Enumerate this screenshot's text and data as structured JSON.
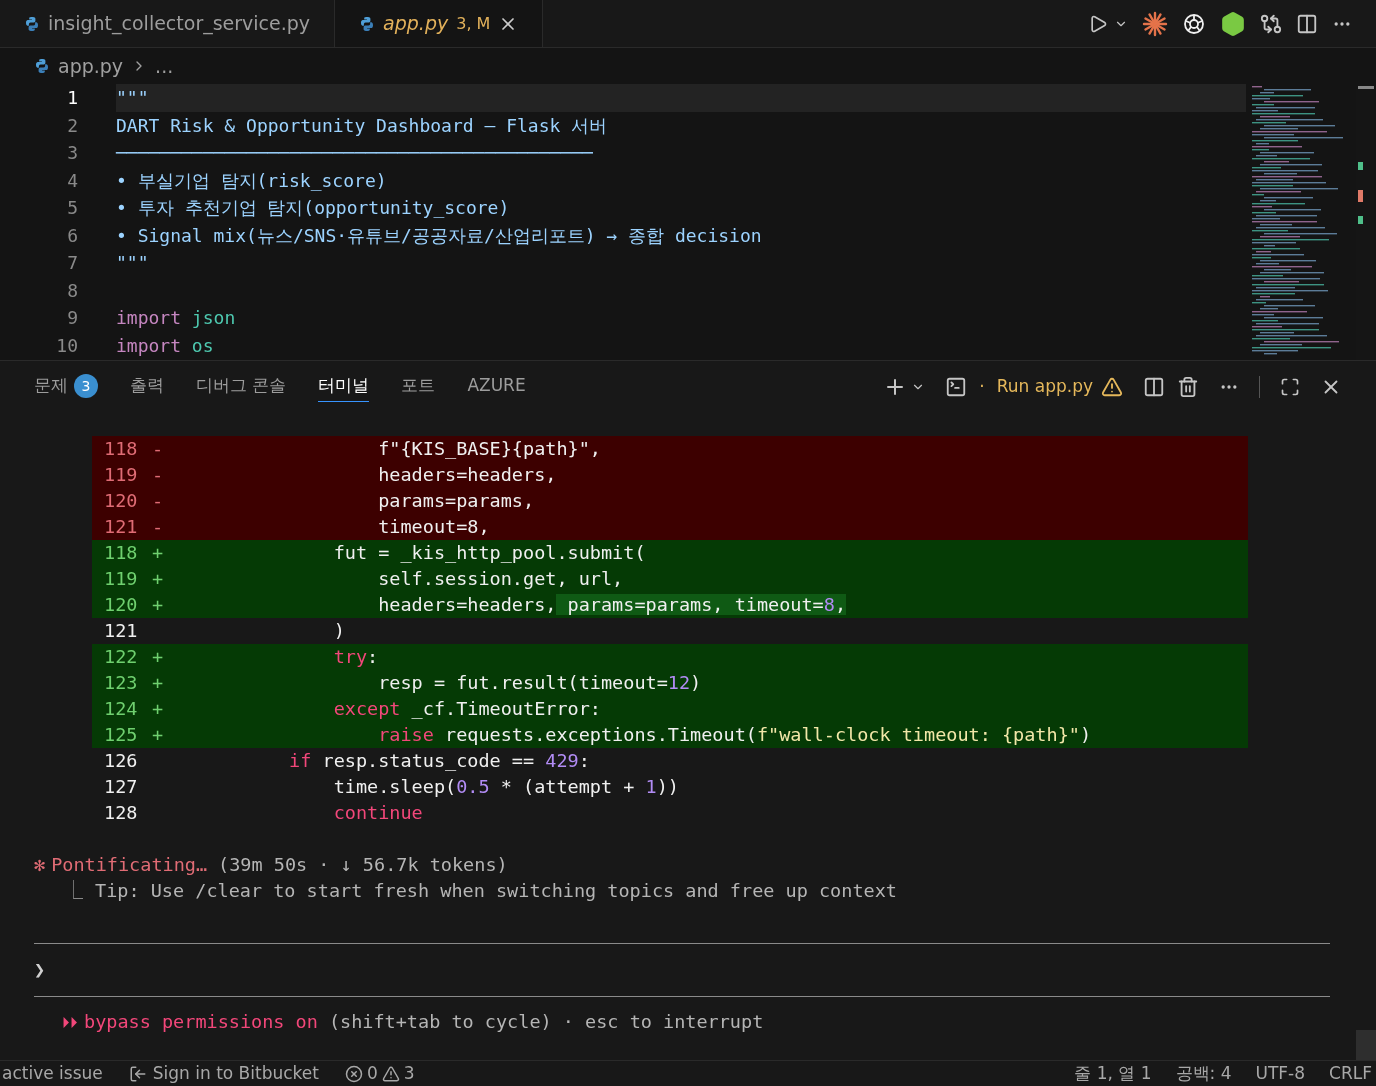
{
  "editor_tabs": [
    {
      "label": "insight_collector_service.py",
      "selected": false,
      "modified": false
    },
    {
      "label": "app.py",
      "badge": "3, M",
      "selected": true,
      "modified": true
    }
  ],
  "breadcrumb": {
    "file": "app.py",
    "rest": "..."
  },
  "editor_lines": [
    {
      "number": "1",
      "current": true,
      "tokens": [
        {
          "text": "\"\"\"",
          "kind": "doc"
        }
      ]
    },
    {
      "number": "2",
      "current": false,
      "tokens": [
        {
          "text": "DART Risk & Opportunity Dashboard — Flask 서버",
          "kind": "doc"
        }
      ]
    },
    {
      "number": "3",
      "current": false,
      "tokens": [
        {
          "text": "────────────────────────────────────────────",
          "kind": "doc"
        }
      ]
    },
    {
      "number": "4",
      "current": false,
      "tokens": [
        {
          "text": "• 부실기업 탐지(risk_score)",
          "kind": "doc"
        }
      ]
    },
    {
      "number": "5",
      "current": false,
      "tokens": [
        {
          "text": "• 투자 추천기업 탐지(opportunity_score)",
          "kind": "doc"
        }
      ]
    },
    {
      "number": "6",
      "current": false,
      "tokens": [
        {
          "text": "• Signal mix(뉴스/SNS·유튜브/공공자료/산업리포트) → 종합 decision",
          "kind": "doc"
        }
      ]
    },
    {
      "number": "7",
      "current": false,
      "tokens": [
        {
          "text": "\"\"\"",
          "kind": "doc"
        }
      ]
    },
    {
      "number": "8",
      "current": false
    },
    {
      "number": "9",
      "current": false,
      "tokens": [
        {
          "text": "import",
          "kind": "keyword"
        },
        {
          "text": " json",
          "kind": "module"
        }
      ]
    },
    {
      "number": "10",
      "current": false,
      "tokens": [
        {
          "text": "import",
          "kind": "keyword"
        },
        {
          "text": " os",
          "kind": "module"
        }
      ]
    }
  ],
  "panel_tabs": [
    {
      "label": "문제",
      "badge": "3",
      "selected": false
    },
    {
      "label": "출력",
      "selected": false
    },
    {
      "label": "디버그 콘솔",
      "selected": false
    },
    {
      "label": "터미널",
      "selected": true
    },
    {
      "label": "포트",
      "selected": false
    },
    {
      "label": "AZURE",
      "selected": false
    }
  ],
  "terminal_separator": "·",
  "terminal_name": "Run app.py",
  "diff_lines": [
    {
      "number": "118",
      "sign": "-",
      "kind": "removed",
      "tokens": [
        {
          "text": "                f\"{KIS_BASE}{path}\",",
          "kind": "plain"
        }
      ]
    },
    {
      "number": "119",
      "sign": "-",
      "kind": "removed",
      "tokens": [
        {
          "text": "                headers=headers,",
          "kind": "plain"
        }
      ]
    },
    {
      "number": "120",
      "sign": "-",
      "kind": "removed",
      "tokens": [
        {
          "text": "                params=params,",
          "kind": "plain"
        }
      ]
    },
    {
      "number": "121",
      "sign": "-",
      "kind": "removed",
      "tokens": [
        {
          "text": "                timeout=8,",
          "kind": "plain"
        }
      ]
    },
    {
      "number": "118",
      "sign": "+",
      "kind": "added",
      "tokens": [
        {
          "text": "            fut = _kis_http_pool.submit(",
          "kind": "plain"
        }
      ]
    },
    {
      "number": "119",
      "sign": "+",
      "kind": "added",
      "tokens": [
        {
          "text": "                self.session.get, url,",
          "kind": "plain"
        }
      ]
    },
    {
      "number": "120",
      "sign": "+",
      "kind": "added",
      "tokens": [
        {
          "text": "                headers=headers,",
          "kind": "plain"
        },
        {
          "text": " params=params, timeout=",
          "kind": "inserted"
        },
        {
          "text": "8",
          "kind": "inserted-number"
        },
        {
          "text": ",",
          "kind": "inserted"
        }
      ]
    },
    {
      "number": "121",
      "kind": "context",
      "tokens": [
        {
          "text": "            )",
          "kind": "plain"
        }
      ]
    },
    {
      "number": "122",
      "sign": "+",
      "kind": "added",
      "tokens": [
        {
          "text": "            try",
          "kind": "keyword"
        },
        {
          "text": ":",
          "kind": "plain"
        }
      ]
    },
    {
      "number": "123",
      "sign": "+",
      "kind": "added",
      "tokens": [
        {
          "text": "                resp = fut.result(timeout=",
          "kind": "plain"
        },
        {
          "text": "12",
          "kind": "number"
        },
        {
          "text": ")",
          "kind": "plain"
        }
      ]
    },
    {
      "number": "124",
      "sign": "+",
      "kind": "added",
      "tokens": [
        {
          "text": "            except",
          "kind": "keyword"
        },
        {
          "text": " _cf.TimeoutError:",
          "kind": "plain"
        }
      ]
    },
    {
      "number": "125",
      "sign": "+",
      "kind": "added",
      "tokens": [
        {
          "text": "                raise",
          "kind": "keyword"
        },
        {
          "text": " requests.exceptions.Timeout(",
          "kind": "plain"
        },
        {
          "text": "f\"wall-clock timeout: {path}\"",
          "kind": "string"
        },
        {
          "text": ")",
          "kind": "plain"
        }
      ]
    },
    {
      "number": "126",
      "kind": "context",
      "tokens": [
        {
          "text": "        if",
          "kind": "keyword"
        },
        {
          "text": " resp.status_code == ",
          "kind": "plain"
        },
        {
          "text": "429",
          "kind": "number"
        },
        {
          "text": ":",
          "kind": "plain"
        }
      ]
    },
    {
      "number": "127",
      "kind": "context",
      "tokens": [
        {
          "text": "            time.sleep(",
          "kind": "plain"
        },
        {
          "text": "0.5",
          "kind": "number"
        },
        {
          "text": " * (attempt + ",
          "kind": "plain"
        },
        {
          "text": "1",
          "kind": "number"
        },
        {
          "text": "))",
          "kind": "plain"
        }
      ]
    },
    {
      "number": "128",
      "kind": "context",
      "tokens": [
        {
          "text": "            continue",
          "kind": "keyword"
        }
      ]
    }
  ],
  "activity": {
    "spinner": "✻",
    "verb": "Pontificating…",
    "detail": "(39m 50s · ↓ 56.7k tokens)",
    "tip_mark": "⎿",
    "tip": "Tip: Use /clear to start fresh when switching topics and free up context"
  },
  "prompt": {
    "symbol": "❯"
  },
  "mode_line": {
    "arrows": "⏵⏵",
    "mode": "bypass permissions on",
    "hint": "(shift+tab to cycle) · esc to interrupt"
  },
  "status_bar": {
    "issue": "active issue",
    "sign_in": "Sign in to Bitbucket",
    "errors": "0",
    "warnings": "3",
    "position": "줄 1, 열 1",
    "spaces": "공백: 4",
    "encoding": "UTF-8",
    "eol": "CRLF"
  }
}
